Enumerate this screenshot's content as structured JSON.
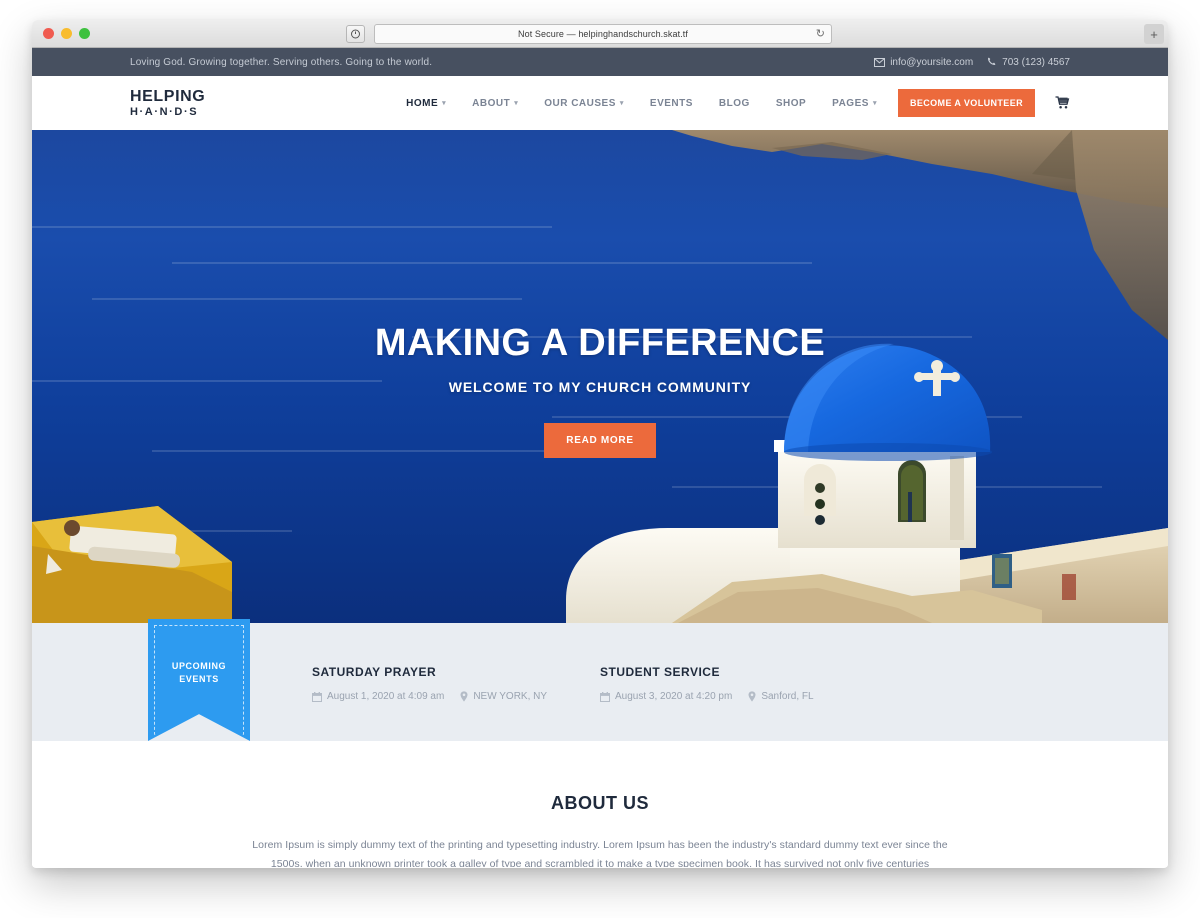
{
  "browser": {
    "url_text": "Not Secure — helpinghandschurch.skat.tf",
    "shield_icon": "shield-icon",
    "reload_icon": "reload-icon",
    "new_tab_label": "+"
  },
  "topbar": {
    "tagline": "Loving God. Growing together. Serving others. Going to the world.",
    "email": "info@yoursite.com",
    "phone": "703 (123) 4567",
    "email_icon": "envelope-icon",
    "phone_icon": "phone-icon",
    "background": "#475060"
  },
  "nav": {
    "logo_top": "HELPING",
    "logo_bottom": "H·A·N·D·S",
    "items": [
      {
        "label": "HOME",
        "has_dropdown": true,
        "active": true
      },
      {
        "label": "ABOUT",
        "has_dropdown": true,
        "active": false
      },
      {
        "label": "OUR CAUSES",
        "has_dropdown": true,
        "active": false
      },
      {
        "label": "EVENTS",
        "has_dropdown": false,
        "active": false
      },
      {
        "label": "BLOG",
        "has_dropdown": false,
        "active": false
      },
      {
        "label": "SHOP",
        "has_dropdown": false,
        "active": false
      },
      {
        "label": "PAGES",
        "has_dropdown": true,
        "active": false
      }
    ],
    "volunteer_button": "BECOME A VOLUNTEER",
    "cart_icon": "cart-icon",
    "accent_color": "#ec6a3c"
  },
  "hero": {
    "title": "MAKING A DIFFERENCE",
    "subtitle": "WELCOME TO MY CHURCH COMMUNITY",
    "cta_label": "READ MORE",
    "sea_color": "#0d47a1",
    "dome_color": "#1565d8"
  },
  "events": {
    "ribbon_line1": "UPCOMING",
    "ribbon_line2": "EVENTS",
    "ribbon_color": "#2d9bf0",
    "calendar_icon": "calendar-icon",
    "pin_icon": "map-pin-icon",
    "list": [
      {
        "title": "SATURDAY PRAYER",
        "date": "August 1, 2020 at 4:09 am",
        "location": "NEW YORK, NY"
      },
      {
        "title": "STUDENT SERVICE",
        "date": "August 3, 2020 at 4:20 pm",
        "location": "Sanford, FL"
      }
    ]
  },
  "about": {
    "title": "ABOUT US",
    "text": "Lorem Ipsum is simply dummy text of the printing and typesetting industry. Lorem Ipsum has been the industry's standard dummy text ever since the 1500s, when an unknown printer took a galley of type and scrambled it to make a type specimen book. It has survived not only five centuries"
  }
}
